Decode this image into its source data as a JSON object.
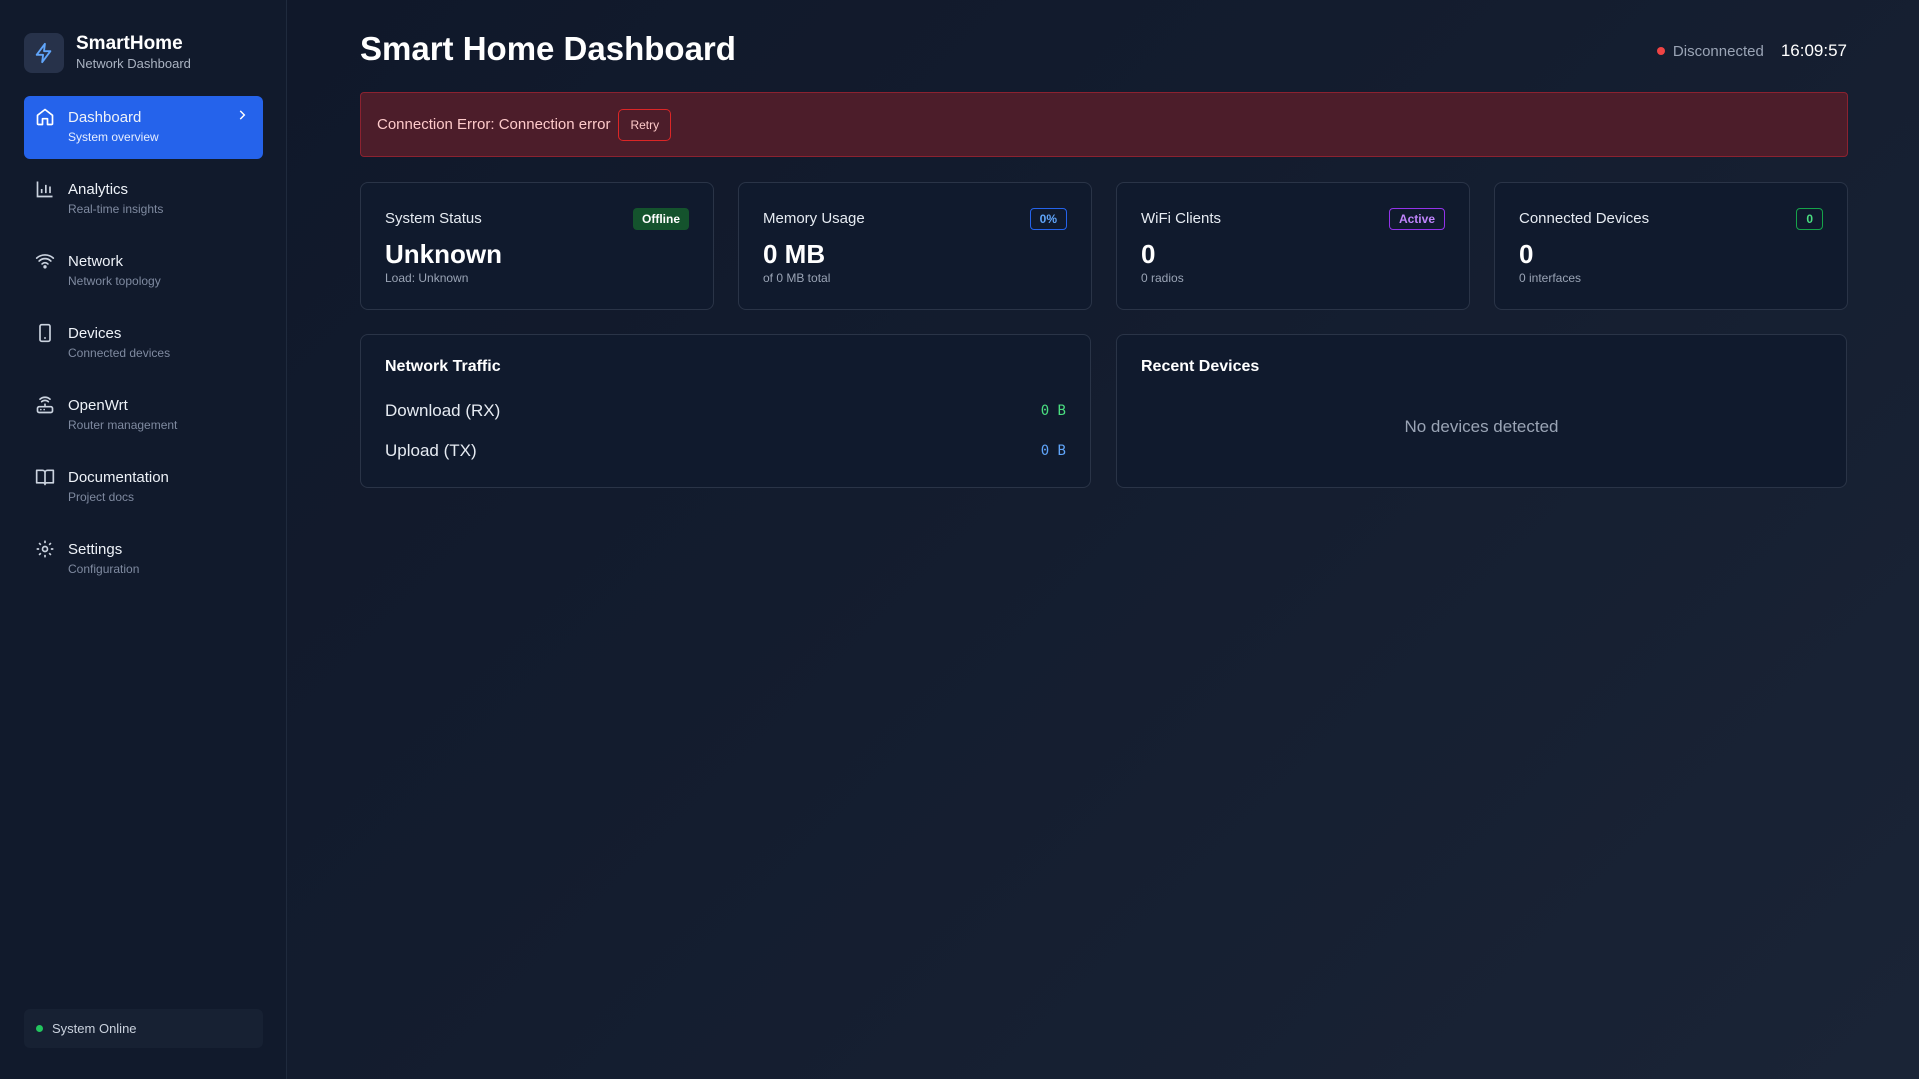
{
  "brand": {
    "name": "SmartHome",
    "subtitle": "Network Dashboard"
  },
  "sidebar": {
    "items": [
      {
        "label": "Dashboard",
        "sub": "System overview",
        "icon": "home-icon",
        "active": true
      },
      {
        "label": "Analytics",
        "sub": "Real-time insights",
        "icon": "bar-chart-icon"
      },
      {
        "label": "Network",
        "sub": "Network topology",
        "icon": "wifi-icon"
      },
      {
        "label": "Devices",
        "sub": "Connected devices",
        "icon": "smartphone-icon"
      },
      {
        "label": "OpenWrt",
        "sub": "Router management",
        "icon": "router-icon"
      },
      {
        "label": "Documentation",
        "sub": "Project docs",
        "icon": "book-icon"
      },
      {
        "label": "Settings",
        "sub": "Configuration",
        "icon": "gear-icon"
      }
    ],
    "footer_status": "System Online"
  },
  "header": {
    "title": "Smart Home Dashboard",
    "connection_status": "Disconnected",
    "time": "16:09:57"
  },
  "error": {
    "message": "Connection Error: Connection error",
    "retry_label": "Retry"
  },
  "stats": [
    {
      "title": "System Status",
      "badge": "Offline",
      "value": "Unknown",
      "sub": "Load: Unknown"
    },
    {
      "title": "Memory Usage",
      "badge": "0%",
      "value": "0 MB",
      "sub": "of 0 MB total"
    },
    {
      "title": "WiFi Clients",
      "badge": "Active",
      "value": "0",
      "sub": "0 radios"
    },
    {
      "title": "Connected Devices",
      "badge": "0",
      "value": "0",
      "sub": "0 interfaces"
    }
  ],
  "traffic": {
    "title": "Network Traffic",
    "download_label": "Download (RX)",
    "download_value": "0 B",
    "upload_label": "Upload (TX)",
    "upload_value": "0 B"
  },
  "recent_devices": {
    "title": "Recent Devices",
    "empty_message": "No devices detected"
  },
  "colors": {
    "accent": "#2563eb",
    "error_bg": "#4c1d2a",
    "online": "#22c55e",
    "offline_dot": "#ef4444"
  }
}
